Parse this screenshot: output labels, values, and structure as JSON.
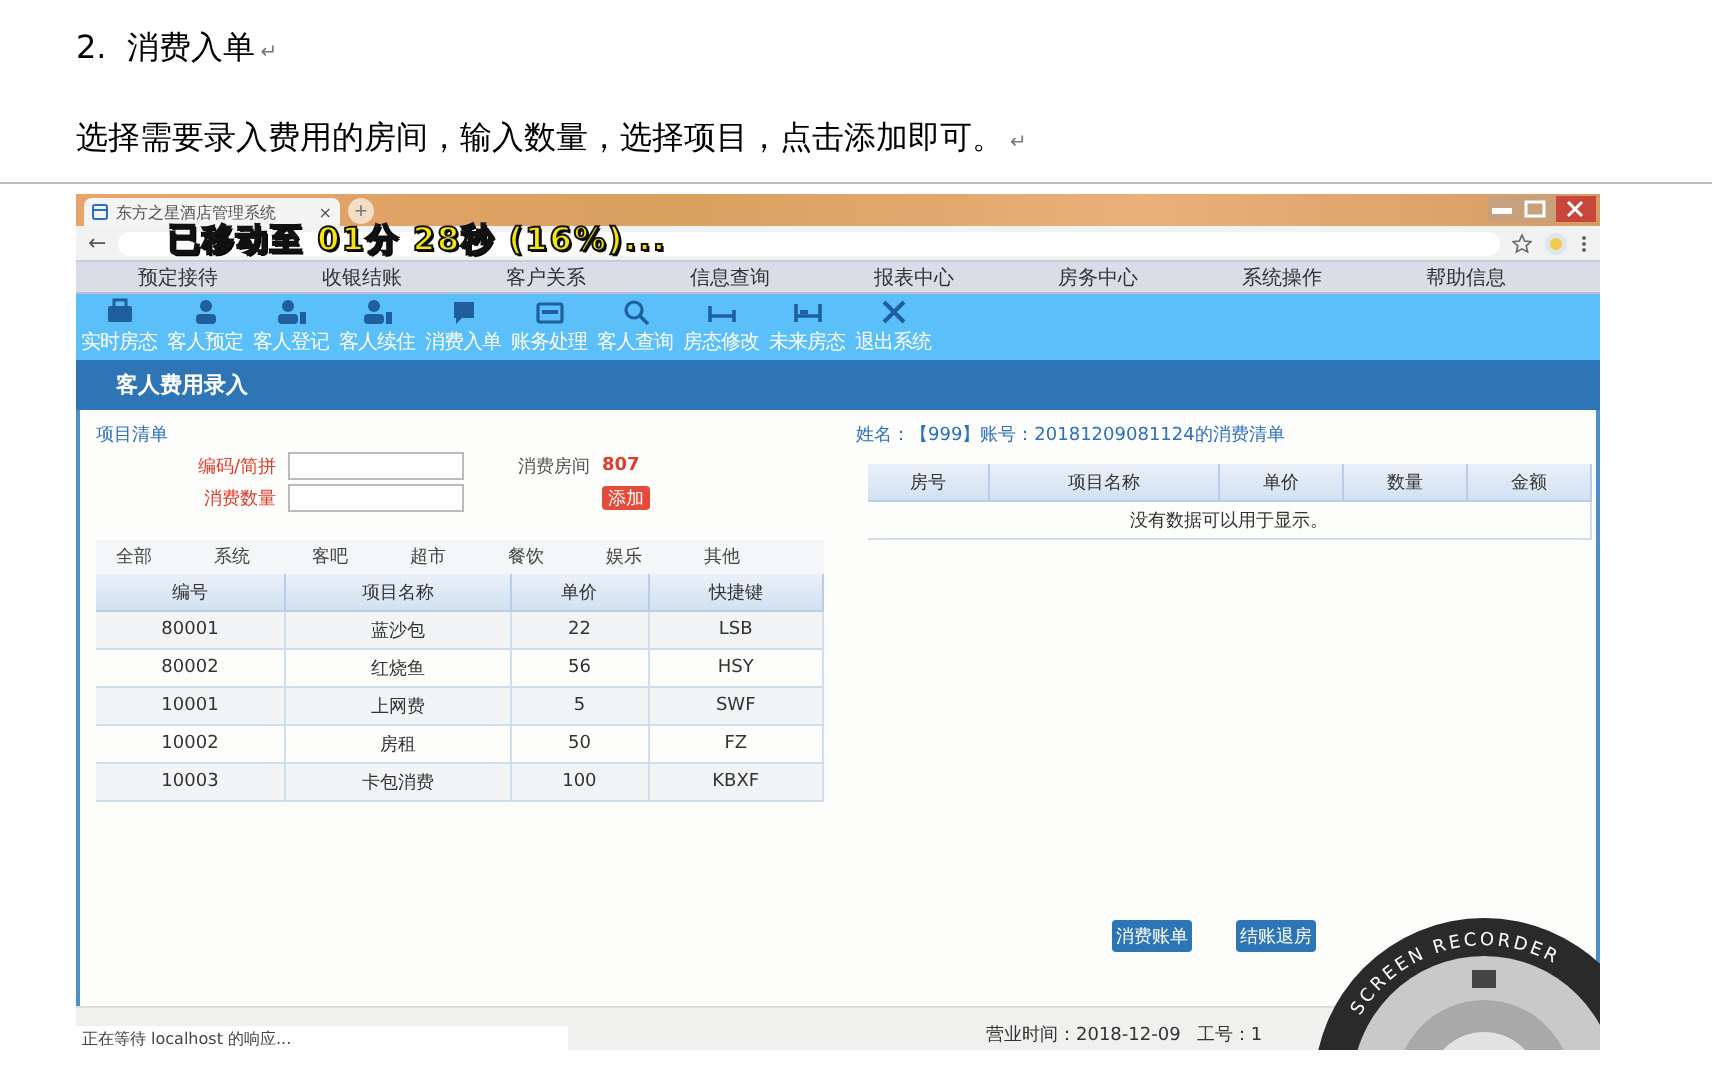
{
  "document": {
    "heading_number": "2.",
    "heading": "消费入单",
    "heading_mark": "↵",
    "paragraph": "选择需要录入费用的房间，输入数量，选择项目，点击添加即可。",
    "paragraph_mark": "↵"
  },
  "browser": {
    "tab_title": "东方之星酒店管理系统",
    "tab_close": "×",
    "new_tab": "+",
    "back": "←"
  },
  "recorder_overlay": "已移动至 01分 28秒 (16%)...",
  "menu": [
    "预定接待",
    "收银结账",
    "客户关系",
    "信息查询",
    "报表中心",
    "房务中心",
    "系统操作",
    "帮助信息"
  ],
  "toolbar": [
    "实时房态",
    "客人预定",
    "客人登记",
    "客人续住",
    "消费入单",
    "账务处理",
    "客人查询",
    "房态修改",
    "未来房态",
    "退出系统"
  ],
  "panel": {
    "title": "客人费用录入",
    "items": {
      "title": "项目清单",
      "code_label": "编码/简拼",
      "quantity_label": "消费数量",
      "room_label": "消费房间",
      "room": "807",
      "add_button": "添加",
      "categories": [
        "全部",
        "系统",
        "客吧",
        "超市",
        "餐饮",
        "娱乐",
        "其他"
      ],
      "columns": [
        "编号",
        "项目名称",
        "单价",
        "快捷键"
      ],
      "rows": [
        [
          "80001",
          "蓝沙包",
          "22",
          "LSB"
        ],
        [
          "80002",
          "红烧鱼",
          "56",
          "HSY"
        ],
        [
          "10001",
          "上网费",
          "5",
          "SWF"
        ],
        [
          "10002",
          "房租",
          "50",
          "FZ"
        ],
        [
          "10003",
          "卡包消费",
          "100",
          "KBXF"
        ]
      ]
    },
    "bill": {
      "title": "姓名：【999】账号：20181209081124的消费清单",
      "columns": [
        "房号",
        "项目名称",
        "单价",
        "数量",
        "金额"
      ],
      "empty": "没有数据可以用于显示。"
    },
    "buttons": [
      "消费账单",
      "结账退房"
    ]
  },
  "status_bar": {
    "loading": "正在等待 localhost 的响应...",
    "business_time": "营业时间：2018-12-09",
    "staff": "工号：1"
  },
  "recorder": {
    "label": "SCREEN RECORDER"
  }
}
